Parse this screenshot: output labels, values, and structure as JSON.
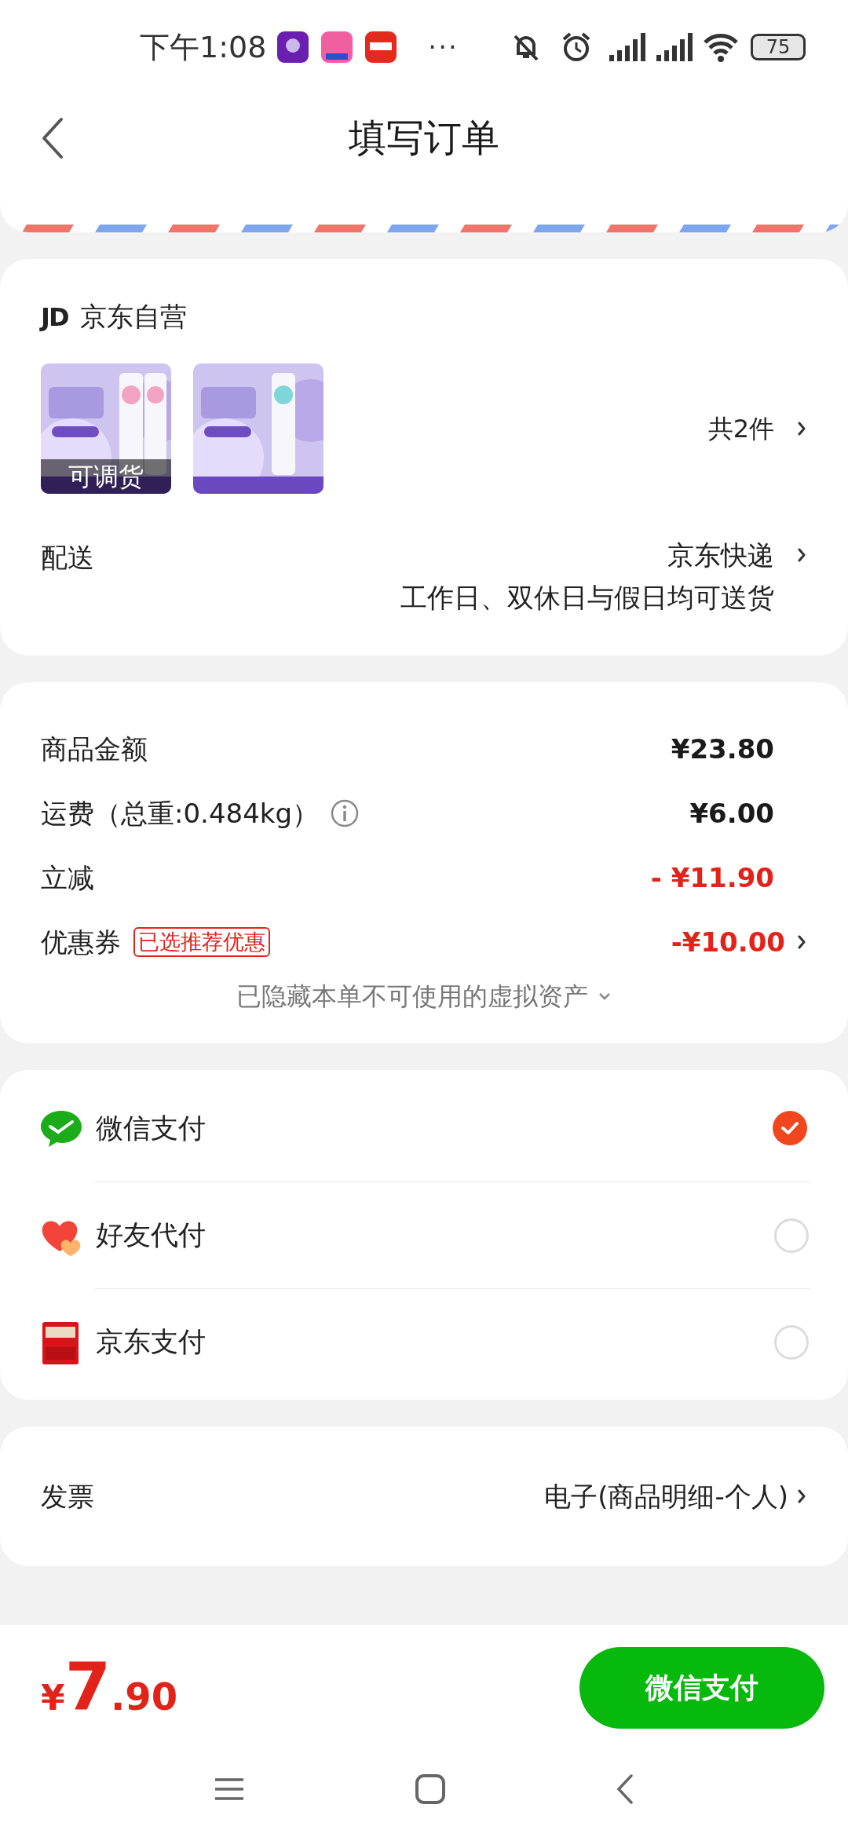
{
  "status_bar": {
    "time": "下午1:08",
    "more": "···",
    "battery": "75"
  },
  "header": {
    "title": "填写订单"
  },
  "store": {
    "logo": "JD",
    "name": "京东自营"
  },
  "products": [
    {
      "kind": "picture",
      "overlay": "可调货"
    },
    {
      "kind": "picture"
    }
  ],
  "item_count": "共2件",
  "delivery": {
    "label": "配送",
    "value": "京东快递",
    "note": "工作日、双休日与假日均可送货"
  },
  "prices": [
    {
      "kind": "plain",
      "label": "商品金额",
      "value": "¥23.80"
    },
    {
      "kind": "info",
      "label": "运费（总重:0.484kg）",
      "value": "¥6.00"
    },
    {
      "kind": "discount",
      "label": "立减",
      "value": "- ¥11.90"
    },
    {
      "kind": "coupon",
      "label": "优惠券",
      "tag": "已选推荐优惠",
      "value": "-¥10.00"
    }
  ],
  "hidden_note": "已隐藏本单不可使用的虚拟资产",
  "payments": [
    {
      "kind": "wechat",
      "label": "微信支付",
      "selected": true
    },
    {
      "kind": "friend",
      "label": "好友代付",
      "selected": false
    },
    {
      "kind": "jdpay",
      "label": "京东支付",
      "selected": false
    }
  ],
  "invoice": {
    "label": "发票",
    "value": "电子(商品明细-个人)"
  },
  "total": {
    "symbol": "¥",
    "integer": "7",
    "decimal": ".90"
  },
  "pay_button": "微信支付"
}
